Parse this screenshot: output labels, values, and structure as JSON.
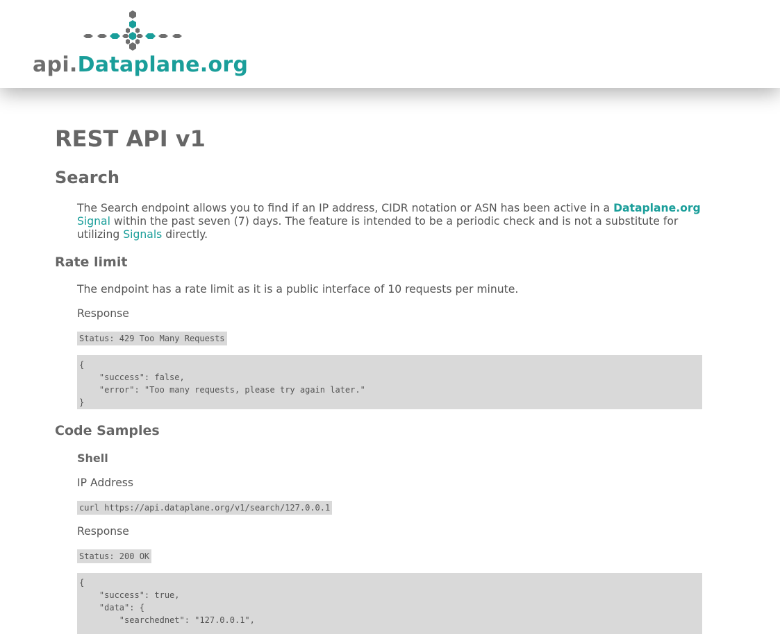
{
  "header": {
    "logo_prefix": "api.",
    "logo_main": "Dataplane",
    "logo_suffix": ".org",
    "colors": {
      "teal": "#1a9e9a",
      "gray": "#6e6e6e"
    }
  },
  "page": {
    "title": "REST API v1"
  },
  "search": {
    "heading": "Search",
    "intro_start": "The Search endpoint allows you to find if an IP address, CIDR notation or ASN has been active in a",
    "brand_main": "Dataplane",
    "brand_suffix": ".org",
    "signal_link": "Signal",
    "intro_middle": "within the past seven (7) days. The feature is intended to be a periodic check and is not a substitute for utilizing",
    "signals_link": "Signals",
    "intro_end": "directly."
  },
  "rate_limit": {
    "heading": "Rate limit",
    "text": "The endpoint has a rate limit as it is a public interface of 10 requests per minute.",
    "response_label": "Response",
    "status": "Status: 429 Too Many Requests",
    "body": "{\n    \"success\": false,\n    \"error\": \"Too many requests, please try again later.\"\n}"
  },
  "code_samples": {
    "heading": "Code Samples",
    "shell_heading": "Shell",
    "ip_label": "IP Address",
    "curl": "curl https://api.dataplane.org/v1/search/127.0.0.1",
    "response_label": "Response",
    "status": "Status: 200 OK",
    "body": "{\n    \"success\": true,\n    \"data\": {\n        \"searchednet\": \"127.0.0.1\","
  }
}
